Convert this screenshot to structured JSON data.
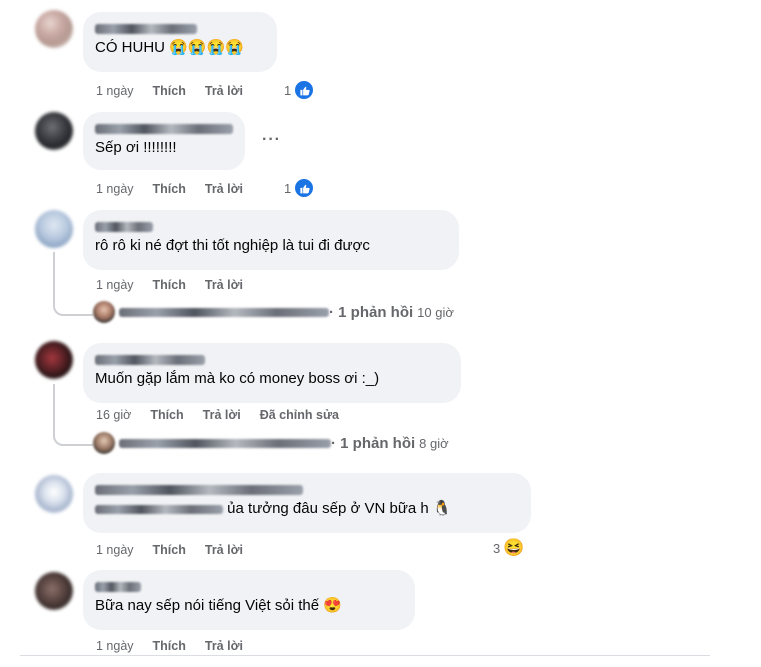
{
  "comments": [
    {
      "author": "",
      "text": "CÓ HUHU",
      "emojis": [
        "😭",
        "😭",
        "😭",
        "😭"
      ],
      "time": "1 ngày",
      "like_label": "Thích",
      "reply_label": "Trả lời",
      "reaction_count": "1",
      "reaction": "like-icon"
    },
    {
      "author": "",
      "text": "Sếp ơi !!!!!!!!",
      "time": "1 ngày",
      "like_label": "Thích",
      "reply_label": "Trả lời",
      "reaction_count": "1",
      "reaction": "like-icon",
      "more": "···"
    },
    {
      "author": "",
      "text": "rô rô ki né đợt thi tốt nghiệp là tui đi được",
      "time": "1 ngày",
      "like_label": "Thích",
      "reply_label": "Trả lời",
      "reply_summary": {
        "count_text": "· 1 phản hồi",
        "time": "10 giờ"
      }
    },
    {
      "author": "",
      "text": "Muốn gặp lắm mà ko có money boss ơi :_)",
      "time": "16 giờ",
      "like_label": "Thích",
      "reply_label": "Trả lời",
      "edited_label": "Đã chỉnh sửa",
      "reply_summary": {
        "count_text": "· 1 phản hồi",
        "time": "8 giờ"
      }
    },
    {
      "author": "",
      "text": "ủa tưởng đâu sếp ở VN bữa h",
      "emojis": [
        "🐧"
      ],
      "time": "1 ngày",
      "like_label": "Thích",
      "reply_label": "Trả lời",
      "reaction_count": "3",
      "reaction": "grinning-face-icon"
    },
    {
      "author": "",
      "text": "Bữa nay sếp nói tiếng Việt sỏi thế",
      "emojis": [
        "😍"
      ],
      "time": "1 ngày",
      "like_label": "Thích",
      "reply_label": "Trả lời"
    }
  ],
  "colors": {
    "bubble": "#f0f2f5",
    "like_blue": "#1b74e4",
    "meta_gray": "#65676b"
  }
}
